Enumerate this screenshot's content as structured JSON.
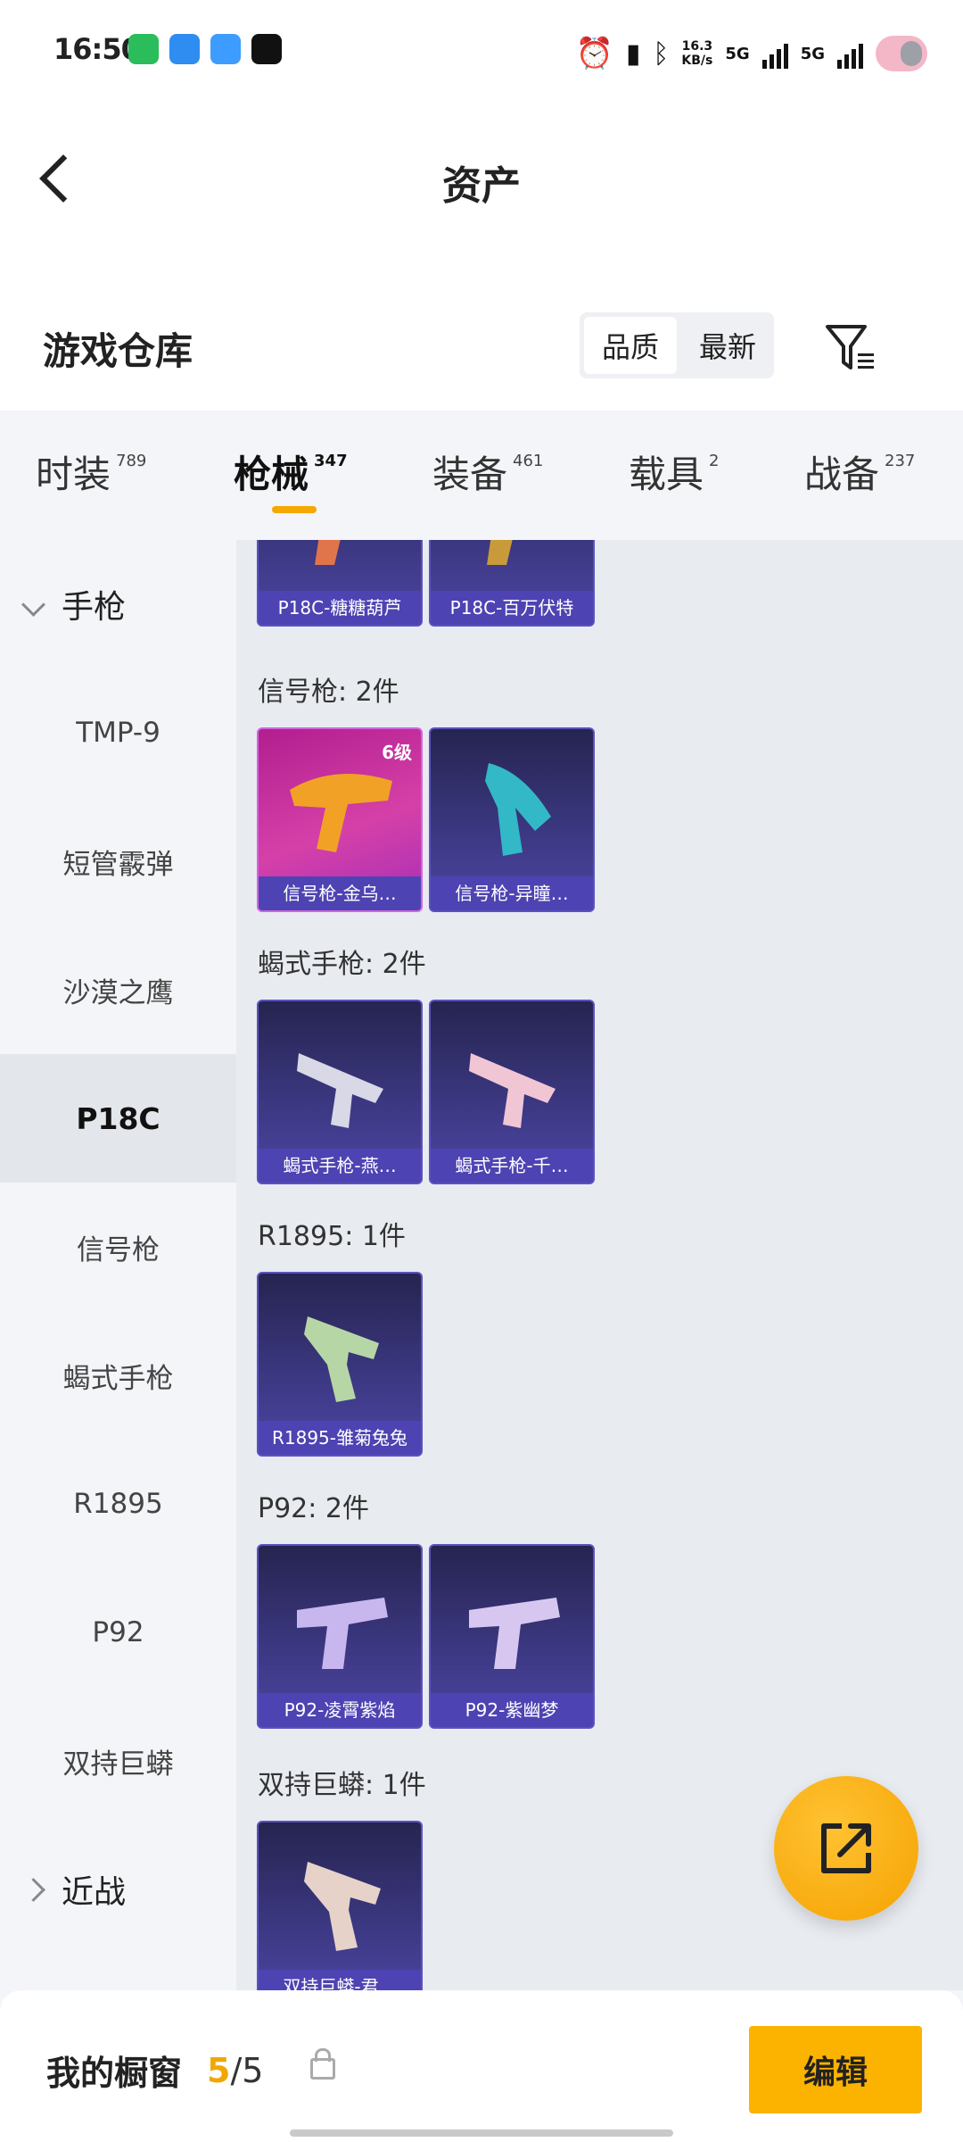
{
  "status_bar": {
    "time": "16:50",
    "net_speed_value": "16.3",
    "net_speed_unit": "KB/s",
    "sim1": "5G",
    "sim2": "5G"
  },
  "nav": {
    "title": "资产"
  },
  "warehouse": {
    "title": "游戏仓库",
    "sort_options": [
      "品质",
      "最新"
    ],
    "sort_selected": "品质"
  },
  "tabs": [
    {
      "label": "时装",
      "count": "789"
    },
    {
      "label": "枪械",
      "count": "347"
    },
    {
      "label": "装备",
      "count": "461"
    },
    {
      "label": "载具",
      "count": "2"
    },
    {
      "label": "战备",
      "count": "237"
    }
  ],
  "active_tab": "枪械",
  "sidebar": {
    "category_expanded": "手枪",
    "subcategories": [
      "TMP-9",
      "短管霰弹",
      "沙漠之鹰",
      "P18C",
      "信号枪",
      "蝎式手枪",
      "R1895",
      "P92",
      "双持巨蟒"
    ],
    "selected": "P18C",
    "category_collapsed": "近战"
  },
  "sections": [
    {
      "title": "",
      "items": [
        {
          "name": "P18C-糖糖葫芦"
        },
        {
          "name": "P18C-百万伏特"
        }
      ]
    },
    {
      "title": "信号枪: 2件",
      "items": [
        {
          "name": "信号枪-金乌…",
          "level": "6级"
        },
        {
          "name": "信号枪-异瞳…"
        }
      ]
    },
    {
      "title": "蝎式手枪: 2件",
      "items": [
        {
          "name": "蝎式手枪-燕…"
        },
        {
          "name": "蝎式手枪-千…"
        }
      ]
    },
    {
      "title": "R1895: 1件",
      "items": [
        {
          "name": "R1895-雏菊兔兔"
        }
      ]
    },
    {
      "title": "P92: 2件",
      "items": [
        {
          "name": "P92-凌霄紫焰"
        },
        {
          "name": "P92-紫幽梦"
        }
      ]
    },
    {
      "title": "双持巨蟒: 1件",
      "items": [
        {
          "name": "双持巨蟒-君…"
        }
      ]
    }
  ],
  "bottom_bar": {
    "showcase_label": "我的橱窗",
    "used": "5",
    "total": "/5",
    "edit_label": "编辑"
  },
  "colors": {
    "accent": "#fbb300",
    "card": "#3b3780",
    "card_highlight": "#c02d9c"
  }
}
